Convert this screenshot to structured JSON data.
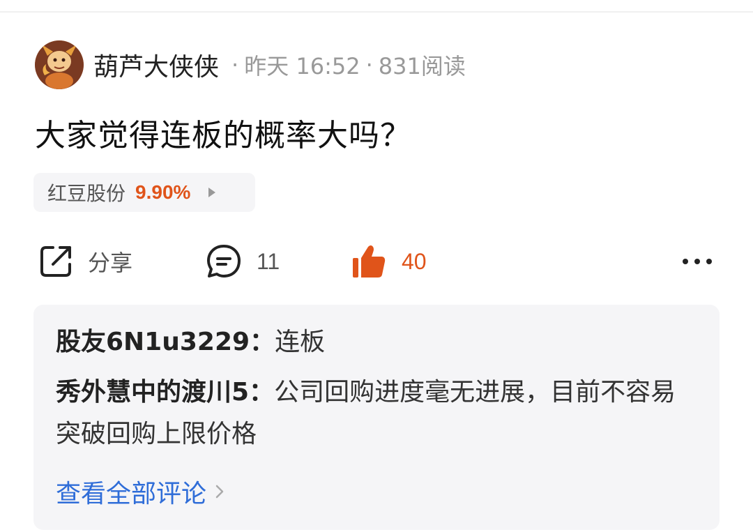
{
  "post": {
    "author": "葫芦大侠侠",
    "date": "昨天 16:52",
    "reads": "831阅读",
    "sep": "·",
    "title": "大家觉得连板的概率大吗？"
  },
  "stock": {
    "name": "红豆股份",
    "change": "9.90%"
  },
  "actions": {
    "share_label": "分享",
    "comment_count": "11",
    "like_count": "40"
  },
  "comments": [
    {
      "user": "股友6N1u3229：",
      "text": "连板"
    },
    {
      "user": "秀外慧中的渡川5：",
      "text": "公司回购进度毫无进展，目前不容易突破回购上限价格"
    }
  ],
  "view_all_label": "查看全部评论",
  "colors": {
    "accent": "#e0541a",
    "link": "#2f6dd8",
    "muted": "#999999"
  }
}
